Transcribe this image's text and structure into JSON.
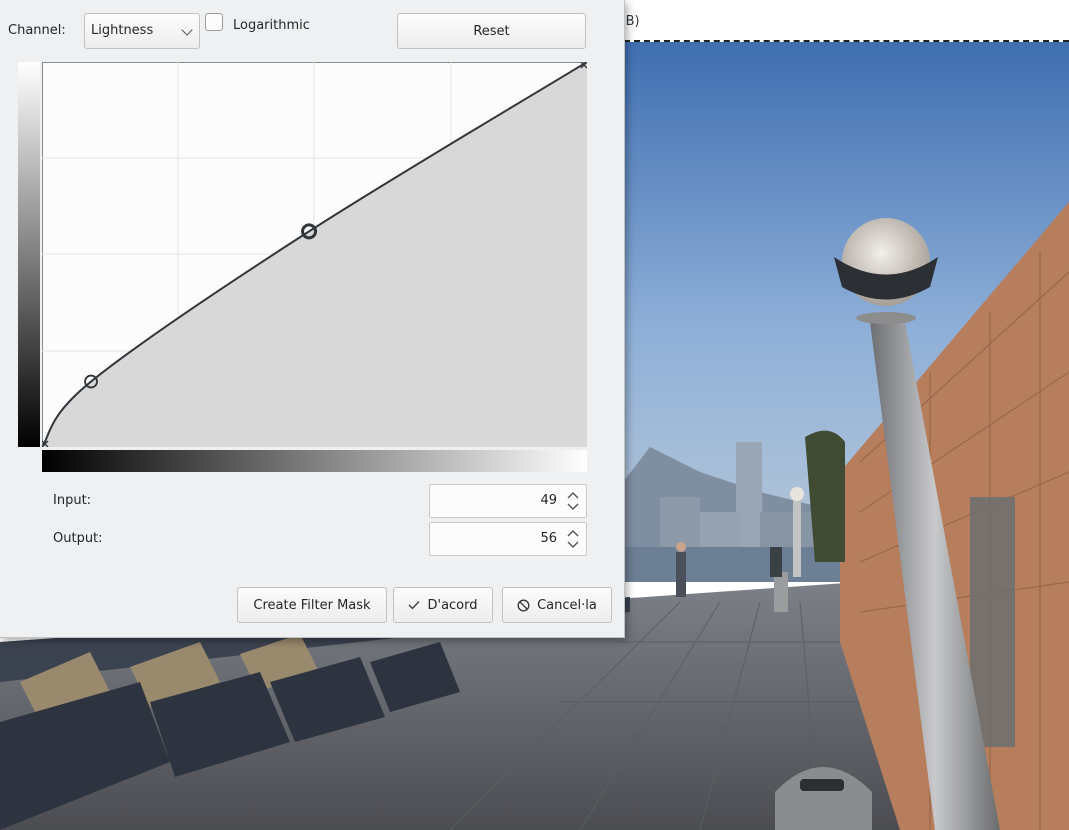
{
  "document": {
    "title_fragment": "iB)"
  },
  "dialog": {
    "channel_label": "Channel:",
    "channel_value": "Lightness",
    "logarithmic_label": "Logarithmic",
    "logarithmic_checked": false,
    "reset_label": "Reset",
    "input_label": "Input:",
    "input_value": "49",
    "output_label": "Output:",
    "output_value": "56",
    "create_filter_mask_label": "Create Filter Mask",
    "ok_label": "D'acord",
    "cancel_label": "Cancel·la"
  },
  "curve": {
    "points": [
      [
        0,
        0
      ],
      [
        9,
        17
      ],
      [
        49,
        56
      ],
      [
        100,
        100
      ]
    ],
    "selected_point_index": 2
  },
  "colors": {
    "accent": "#f67400",
    "dialog_bg": "#eff0f1",
    "curve_fill": "#d8d8d8",
    "curve_line": "#31363b"
  }
}
